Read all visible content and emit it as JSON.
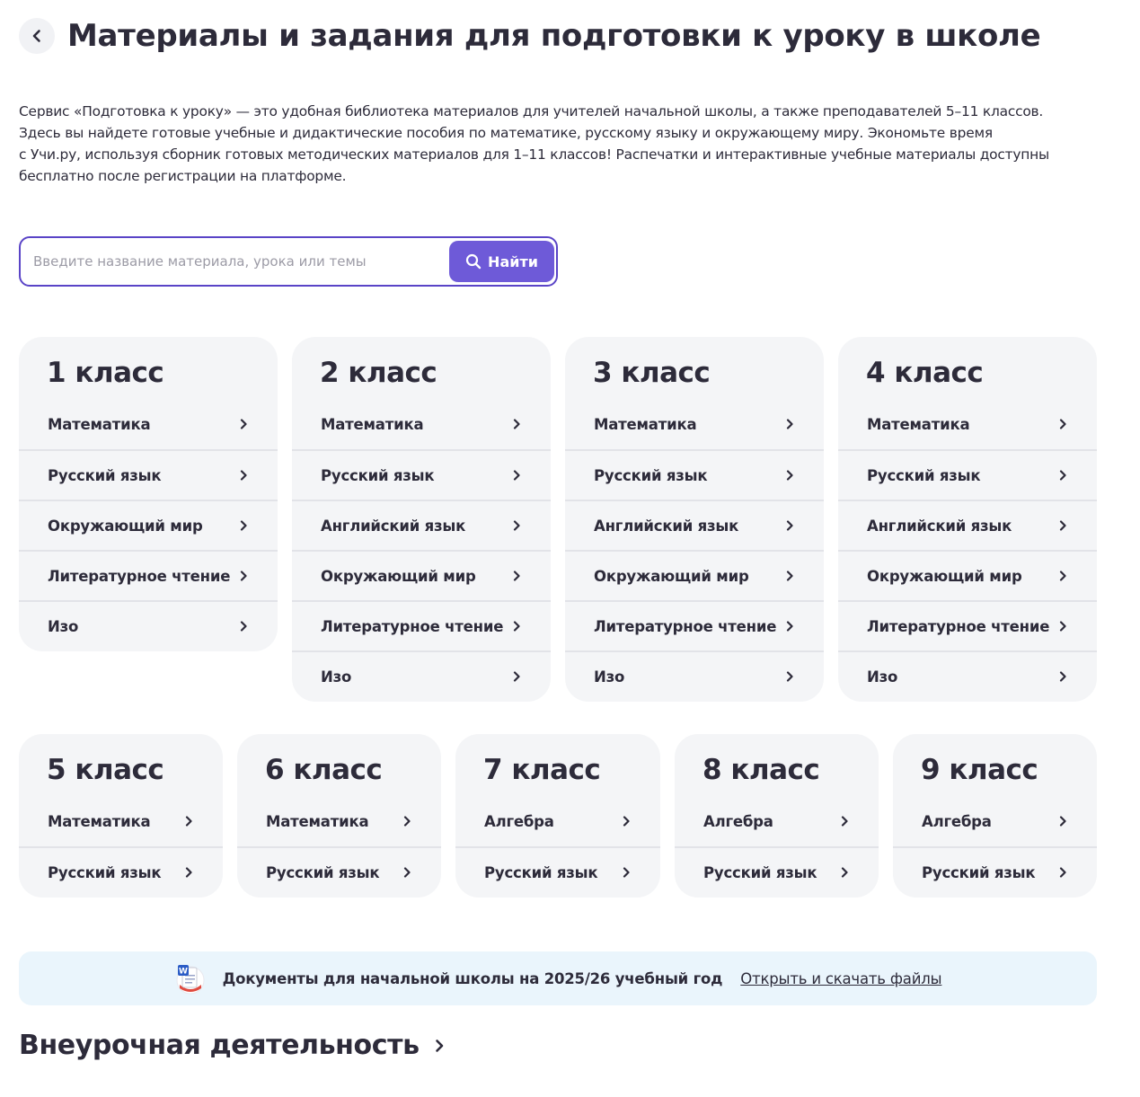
{
  "header": {
    "title": "Материалы и задания для подготовки к уроку в школе"
  },
  "intro": {
    "lines": [
      "Сервис «Подготовка к уроку» — это удобная библиотека материалов для учителей начальной школы, а также преподавателей 5–11 классов.",
      "Здесь вы найдете готовые учебные и дидактические пособия по математике, русскому языку и окружающему миру. Экономьте время",
      "с Учи.ру, используя сборник готовых методических материалов для 1–11 классов! Распечатки и интерактивные учебные материалы доступны",
      "бесплатно после регистрации на платформе."
    ]
  },
  "search": {
    "placeholder": "Введите название материала, урока или темы",
    "value": "",
    "button_label": "Найти"
  },
  "grades": [
    {
      "title": "1 класс",
      "subjects": [
        "Математика",
        "Русский язык",
        "Окружающий мир",
        "Литературное чтение",
        "Изо"
      ]
    },
    {
      "title": "2 класс",
      "subjects": [
        "Математика",
        "Русский язык",
        "Английский язык",
        "Окружающий мир",
        "Литературное чтение",
        "Изо"
      ]
    },
    {
      "title": "3 класс",
      "subjects": [
        "Математика",
        "Русский язык",
        "Английский язык",
        "Окружающий мир",
        "Литературное чтение",
        "Изо"
      ]
    },
    {
      "title": "4 класс",
      "subjects": [
        "Математика",
        "Русский язык",
        "Английский язык",
        "Окружающий мир",
        "Литературное чтение",
        "Изо"
      ]
    },
    {
      "title": "5 класс",
      "subjects": [
        "Математика",
        "Русский язык"
      ]
    },
    {
      "title": "6 класс",
      "subjects": [
        "Математика",
        "Русский язык"
      ]
    },
    {
      "title": "7 класс",
      "subjects": [
        "Алгебра",
        "Русский язык"
      ]
    },
    {
      "title": "8 класс",
      "subjects": [
        "Алгебра",
        "Русский язык"
      ]
    },
    {
      "title": "9 класс",
      "subjects": [
        "Алгебра",
        "Русский язык"
      ]
    }
  ],
  "banner": {
    "text": "Документы для начальной школы на 2025/26 учебный год",
    "link": "Открыть и скачать файлы",
    "icon": "word-document-icon"
  },
  "section": {
    "title": "Внеурочная деятельность"
  },
  "colors": {
    "accent": "#6e5ad8",
    "search_border": "#5a44c7",
    "card_bg": "#f4f5f7",
    "banner_bg": "#eaf5fc",
    "text": "#2d2b3a"
  }
}
